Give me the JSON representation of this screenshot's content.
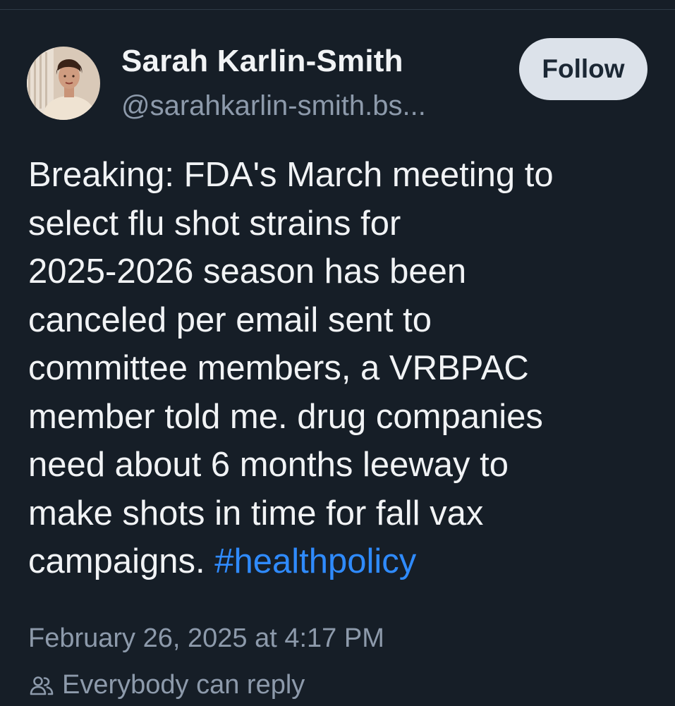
{
  "post": {
    "author": {
      "display_name": "Sarah Karlin-Smith",
      "handle": "@sarahkarlin-smith.bs..."
    },
    "follow_label": "Follow",
    "text_before_tag": "Breaking: FDA's March meeting to\nselect flu shot strains for\n2025-2026 season has been\ncanceled per email sent to\ncommittee members, a VRBPAC\nmember told me.  drug companies\nneed about 6 months leeway to\nmake shots in time for fall vax\ncampaigns. ",
    "hashtag": "#healthpolicy",
    "timestamp": "February 26, 2025 at 4:17 PM",
    "reply_setting": "Everybody can reply"
  },
  "icons": {
    "reply_setting_icon": "people-icon"
  },
  "colors": {
    "background": "#161e27",
    "text": "#f1f3f5",
    "muted": "#8d9aab",
    "link": "#2f8bff",
    "follow_button_bg": "#dce2ea"
  }
}
